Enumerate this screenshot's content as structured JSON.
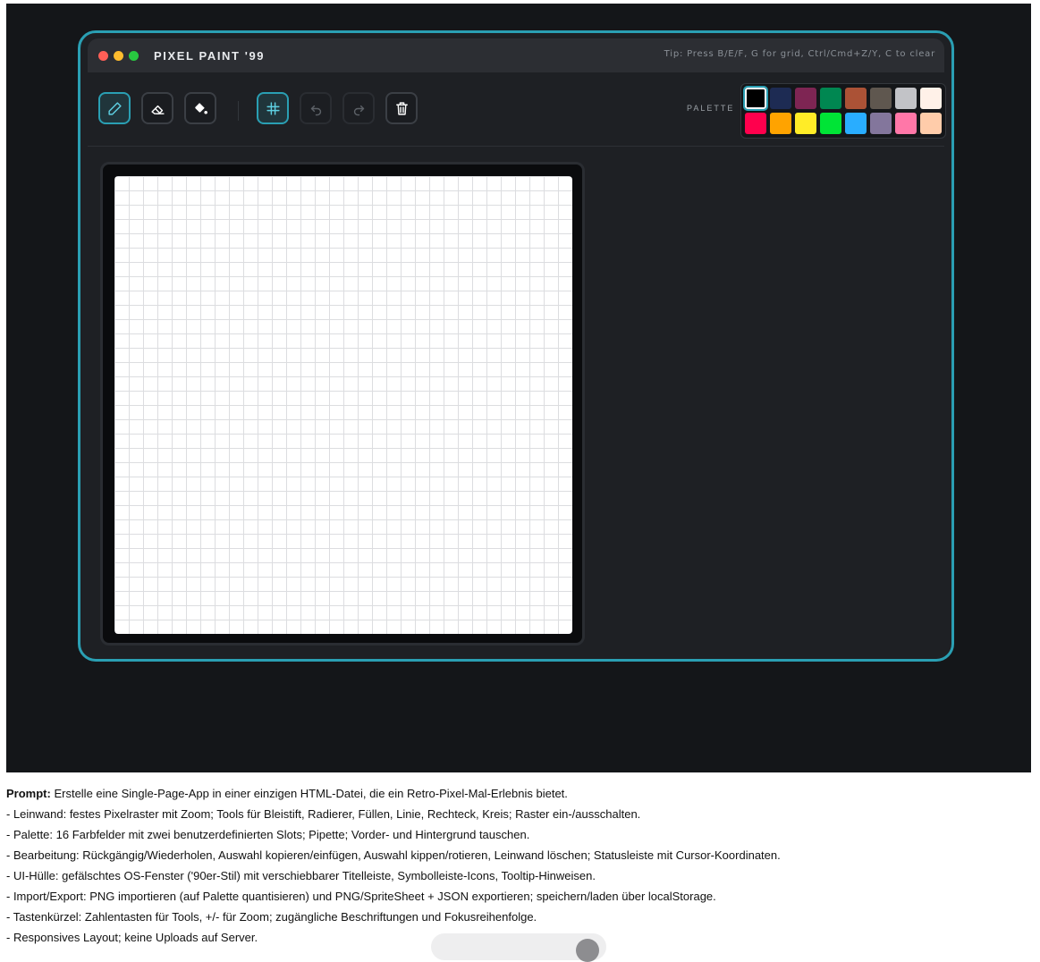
{
  "window": {
    "title": "PIXEL PAINT '99",
    "tip": "Tip: Press B/E/F, G for grid, Ctrl/Cmd+Z/Y, C to clear",
    "traffic_lights": [
      "#ff5f57",
      "#febc2e",
      "#28c840"
    ]
  },
  "toolbar": {
    "tools": [
      {
        "name": "pencil-icon",
        "state": "active"
      },
      {
        "name": "eraser-icon",
        "state": "normal"
      },
      {
        "name": "fill-icon",
        "state": "normal"
      }
    ],
    "grid_toggle": {
      "name": "grid-icon",
      "state": "active"
    },
    "undo": {
      "name": "undo-icon",
      "state": "disabled"
    },
    "redo": {
      "name": "redo-icon",
      "state": "disabled"
    },
    "clear": {
      "name": "trash-icon",
      "state": "normal"
    }
  },
  "palette": {
    "label": "PALETTE",
    "selected_index": 0,
    "colors": [
      "#000000",
      "#1d2b53",
      "#7e2553",
      "#008751",
      "#ab5236",
      "#5f574f",
      "#c2c3c7",
      "#fff1e8",
      "#ff004d",
      "#ffa300",
      "#ffec27",
      "#00e436",
      "#29adff",
      "#83769c",
      "#ff77a8",
      "#ffccaa"
    ]
  },
  "canvas": {
    "grid_visible": true,
    "grid_cells": 32
  },
  "colors": {
    "accent": "#2a9fb3",
    "background": "#141619",
    "window": "#1e2024"
  },
  "prompt": {
    "label": "Prompt:",
    "intro": " Erstelle eine Single-Page-App in einer einzigen HTML-Datei, die ein Retro-Pixel-Mal-Erlebnis bietet.",
    "lines": [
      "- Leinwand: festes Pixelraster mit Zoom; Tools für Bleistift, Radierer, Füllen, Linie, Rechteck, Kreis; Raster ein-/ausschalten.",
      "- Palette: 16 Farbfelder mit zwei benutzerdefinierten Slots; Pipette; Vorder- und Hintergrund tauschen.",
      "- Bearbeitung: Rückgängig/Wiederholen, Auswahl kopieren/einfügen, Auswahl kippen/rotieren, Leinwand löschen; Statusleiste mit Cursor-Koordinaten.",
      "- UI-Hülle: gefälschtes OS-Fenster ('90er-Stil) mit verschiebbarer Titelleiste, Symbolleiste-Icons, Tooltip-Hinweisen.",
      "- Import/Export: PNG importieren (auf Palette quantisieren) und PNG/SpriteSheet + JSON exportieren; speichern/laden über localStorage.",
      "- Tastenkürzel: Zahlentasten für Tools, +/- für Zoom; zugängliche Beschriftungen und Fokusreihenfolge.",
      "- Responsives Layout; keine Uploads auf Server."
    ]
  }
}
